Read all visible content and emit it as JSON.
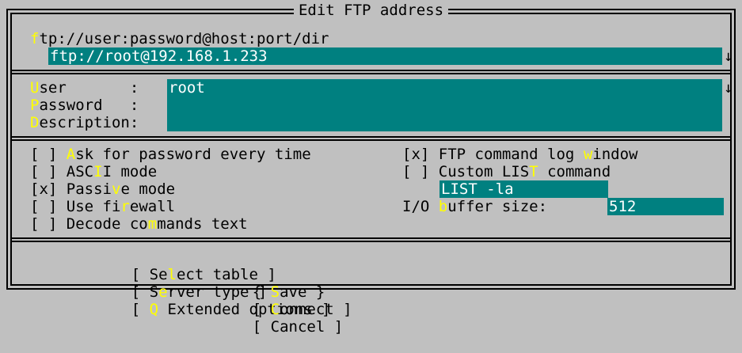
{
  "dialog": {
    "title": "Edit FTP address"
  },
  "url_section": {
    "hint_hot": "f",
    "hint_rest": "tp://user:password@host:port/dir",
    "value": "ftp://root@192.168.1.233",
    "history_arrow": "↓"
  },
  "account": {
    "user_hot": "U",
    "user_rest": "ser        :",
    "user_value": "root",
    "user_arrow": "↓",
    "password_hot": "P",
    "password_rest": "assword    :",
    "password_value": "",
    "description_hot": "D",
    "description_rest": "escription:",
    "description_value": ""
  },
  "options": {
    "ask_password": {
      "box": "[ ]",
      "pre": "",
      "hot": "A",
      "post": "sk for password every time",
      "checked": false
    },
    "ascii_mode": {
      "box": "[ ]",
      "pre": "ASC",
      "hot": "I",
      "post": "I mode",
      "checked": false
    },
    "passive_mode": {
      "box": "[x]",
      "pre": "Passi",
      "hot": "v",
      "post": "e mode",
      "checked": true
    },
    "use_firewall": {
      "box": "[ ]",
      "pre": "Use fi",
      "hot": "r",
      "post": "ewall",
      "checked": false
    },
    "decode_commands": {
      "box": "[ ]",
      "pre": "Decode co",
      "hot": "m",
      "post": "mands text",
      "checked": false
    },
    "ftp_log_window": {
      "box": "[x]",
      "pre": "FTP command log ",
      "hot": "w",
      "post": "indow",
      "checked": true
    },
    "custom_list": {
      "box": "[ ]",
      "pre": "Custom LIS",
      "hot": "T",
      "post": " command",
      "checked": false
    },
    "list_command_value": "LIST -la",
    "buffer_pre": "I/O ",
    "buffer_hot": "b",
    "buffer_post": "uffer size:",
    "buffer_value": "512"
  },
  "buttons": {
    "select_table": {
      "open": "[ Se",
      "hot": "l",
      "close": "ect table ]"
    },
    "server_type": {
      "open": "[ S",
      "hot": "e",
      "close": "rver type ]"
    },
    "extended": {
      "open": "[ ",
      "hot": "Q",
      "close": " Extended options ]"
    },
    "save": {
      "open": "{ ",
      "hot": "S",
      "close": "ave }"
    },
    "connect": {
      "open": "[ ",
      "hot": "C",
      "close": "onnect ]"
    },
    "cancel": {
      "label": "[ Cancel ]"
    }
  }
}
